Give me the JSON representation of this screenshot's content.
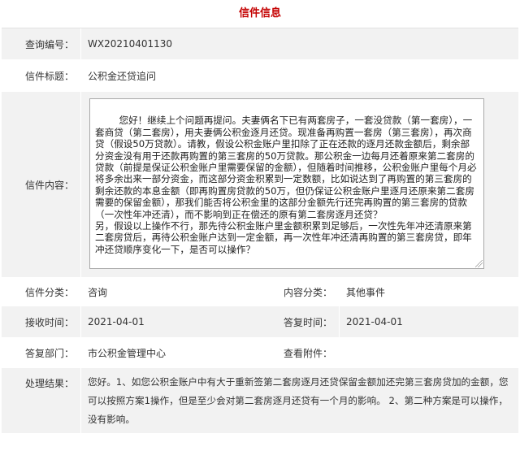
{
  "page": {
    "title": "信件信息"
  },
  "fields": {
    "query_id": {
      "label": "查询编号：",
      "value": "WX20210401130"
    },
    "letter_title": {
      "label": "信件标题：",
      "value": "公积金还贷追问"
    },
    "content": {
      "label": "信件内容：",
      "value": "您好！继续上个问题再提问。夫妻俩名下已有两套房子，一套没贷款（第一套房），一套商贷（第二套房），用夫妻俩公积金逐月还贷。现准备再购置一套房（第三套房），再次商贷（假设50万贷款）。请教，假设公积金账户里扣除了正在还款的逐月还款金额后，剩余部分资金没有用于还款再购置的第三套房的50万贷款。那公积金一边每月还着原来第二套房的贷款（前提是保证公积金账户里需要保留的金额），但随着时间推移，公积金账户里每个月必将多余出来一部分资金，而这部分资金积累到一定数额，比如说达到了再购置的第三套房的剩余还款的本息金额（即再购置房贷款的50万，但仍保证公积金账户里逐月还原来第二套房需要的保留金额），那我们能否将公积金里的这部分金额先行还完再购置的第三套房的贷款（一次性年冲还清），而不影响到正在偿还的原有第二套房逐月还贷？\n另，假设以上操作不行，那先待公积金账户里金额积累到足够后，一次性先年冲还清原来第二套房贷后，再待公积金账户达到一定金额，再一次性年冲还清再购置的第三套房贷，即年冲还贷顺序变化一下，是否可以操作？"
    },
    "category": {
      "label": "信件分类：",
      "value": "咨询"
    },
    "content_category": {
      "label": "内容分类：",
      "value": "其他事件"
    },
    "received_time": {
      "label": "接收时间：",
      "value": "2021-04-01"
    },
    "reply_time": {
      "label": "答复时间：",
      "value": "2021-04-01"
    },
    "reply_dept": {
      "label": "答复部门：",
      "value": "市公积金管理中心"
    },
    "attachments": {
      "label": "查看附件：",
      "value": ""
    },
    "result": {
      "label": "处理结果：",
      "value": "您好。1、如您公积金账户中有大于重新签第二套房逐月还贷保留金额加还完第三套房贷加的金额，您可以按照方案1操作，但是至少会对第二套房逐月还贷有一个月的影响。 2、第二种方案是可以操作，没有影响。"
    }
  },
  "colors": {
    "title": "#c40000",
    "row_shade": "#f2f2f2",
    "border": "#a9a9a9"
  }
}
